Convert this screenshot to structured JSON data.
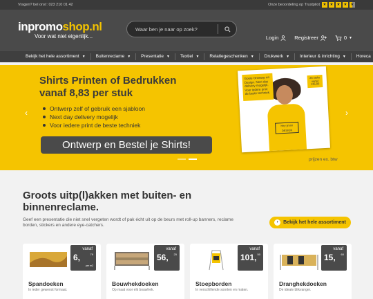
{
  "topbar": {
    "phone": "Vragen? bel ons!: 023 210 01 42",
    "trustpilot": "Onze beoordeling op Trustpilot",
    "stars": 4.5
  },
  "header": {
    "logo_part1": "inpromo",
    "logo_part2": "shop.nl",
    "logo_tagline": "Voor wat niet eigenlijk...",
    "search_placeholder": "Waar ben je naar op zoek?",
    "login": "Login",
    "register": "Registreer",
    "cart_count": "0"
  },
  "nav": {
    "items": [
      "Bekijk het hele assortiment",
      "Buitenreclame",
      "Presentatie",
      "Textiel",
      "Relatiegeschenken",
      "Drukwerk",
      "Interieur & inrichting",
      "Horeca"
    ]
  },
  "hero": {
    "title_line1": "Shirts Printen of Bedrukken",
    "title_line2": "vanaf 8,83 per stuk",
    "bullets": [
      "Ontwerp zelf of gebruik een sjabloon",
      "Next day delivery mogelijk",
      "Voor iedere print de beste techniek"
    ],
    "cta": "Ontwerp en Bestel je Shirts!",
    "note": "prijzen ex. btw",
    "image_bubble": "Goeie Ontwerp en Design. Next day delivery mogelijk. Voor iedere print de beste techniek.",
    "image_badge": "25 stuks vanaf 135,00",
    "shirt_print": "Hey jimmi DESIGN",
    "slide_count": 2,
    "active_slide": 1
  },
  "section": {
    "title": "Groots uitp(l)akken met buiten- en binnenreclame.",
    "description": "Geef een presentatie die niet snel vergeten wordt of pak écht uit op de beurs met roll-up banners, reclame borden, stickers en andere eye-catchers.",
    "button": "Bekijk het hele assortiment"
  },
  "cards": [
    {
      "title": "Spandoeken",
      "desc": "In ieder gewenst formaat.",
      "vanaf": "vanaf",
      "price": "6,",
      "cents": "79",
      "unit": "per m2"
    },
    {
      "title": "Bouwhekdoeken",
      "desc": "Op maat voor elk bouwhek.",
      "vanaf": "vanaf",
      "price": "56,",
      "cents": "25",
      "unit": ""
    },
    {
      "title": "Stoepborden",
      "desc": "In verschillende soorten en maten.",
      "vanaf": "vanaf",
      "price": "101,",
      "cents": "50",
      "unit": ""
    },
    {
      "title": "Dranghekdoeken",
      "desc": "De ideale blikvanger.",
      "vanaf": "vanaf",
      "price": "15,",
      "cents": "60",
      "unit": ""
    }
  ],
  "colors": {
    "accent": "#f5c400",
    "header_bg": "#4a4a4a",
    "nav_bg": "#3f3f3f"
  }
}
